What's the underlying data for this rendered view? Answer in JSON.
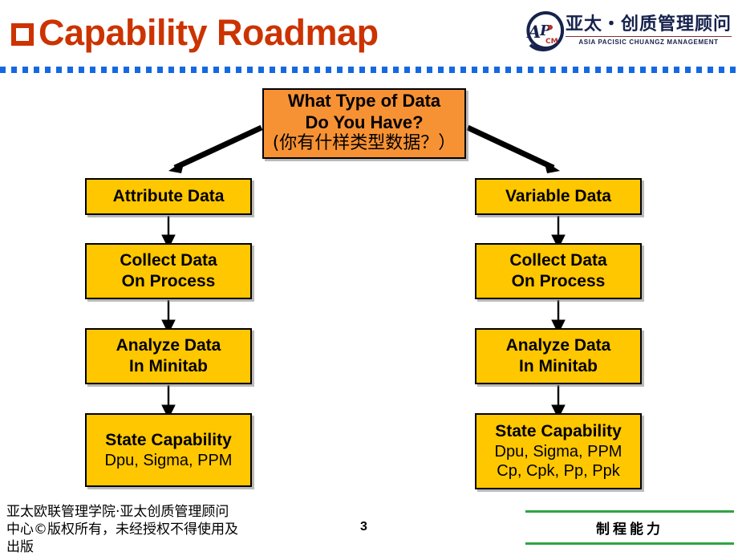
{
  "header": {
    "title": "Capability Roadmap",
    "bullet_icon": "square-bullet-icon",
    "title_color": "#CC3300",
    "divider_color": "#1569E0"
  },
  "logo": {
    "mark_text_primary": "AP",
    "mark_text_secondary": "CM",
    "chinese_name": "亚太・创质管理顾问",
    "english_name": "ASIA PACISIC CHUANGZ MANAGEMENT",
    "mark_color": "#16224d"
  },
  "flowchart": {
    "colors": {
      "decision_fill": "#F79234",
      "process_fill": "#FFC700",
      "border": "#000000"
    },
    "question": {
      "line1": "What Type of Data",
      "line2": "Do You Have?",
      "line3": "(你有什样类型数据？）"
    },
    "left_branch": {
      "step1": "Attribute Data",
      "step2_line1": "Collect Data",
      "step2_line2": "On Process",
      "step3_line1": "Analyze Data",
      "step3_line2": "In Minitab",
      "step4_line1": "State Capability",
      "step4_line2": "Dpu, Sigma, PPM"
    },
    "right_branch": {
      "step1": "Variable Data",
      "step2_line1": "Collect Data",
      "step2_line2": "On Process",
      "step3_line1": "Analyze Data",
      "step3_line2": "In Minitab",
      "step4_line1": "State Capability",
      "step4_line2": "Dpu, Sigma, PPM",
      "step4_line3": "Cp, Cpk, Pp, Ppk"
    }
  },
  "footer": {
    "copyright_line1": "亚太欧联管理学院·亚太创质管理顾问",
    "copyright_line2": "中心©版权所有，未经授权不得使用及",
    "copyright_line3": "出版",
    "page_number": "3",
    "topic": "制程能力",
    "rule_color": "#2FA342"
  }
}
